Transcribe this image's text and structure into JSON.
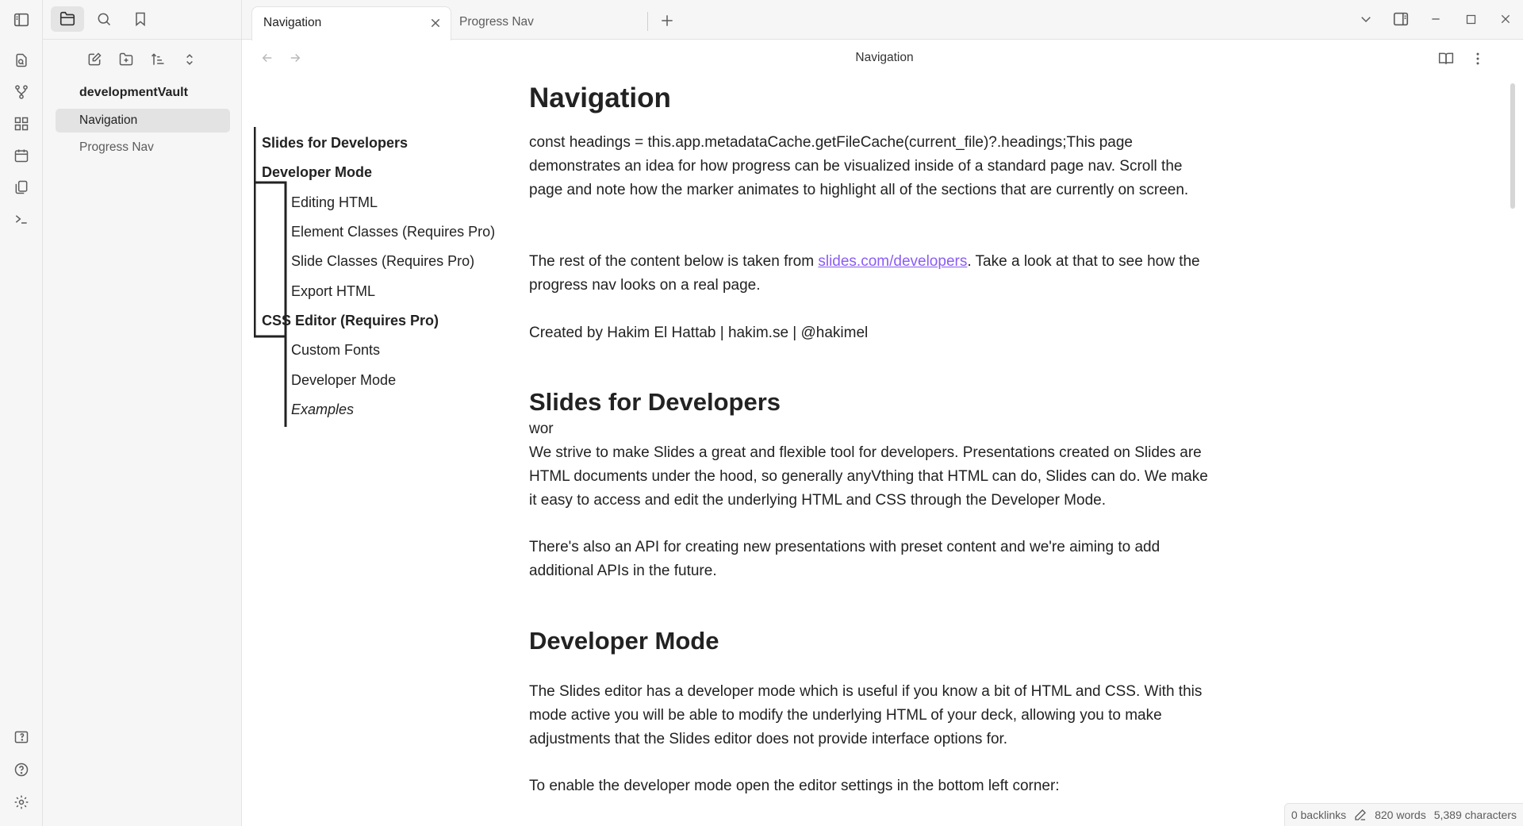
{
  "ribbon": {
    "top_icons": [
      "sidebar-toggle-icon",
      "open-quick-switcher-icon",
      "graph-view-icon",
      "canvas-icon",
      "daily-note-icon",
      "templates-icon",
      "command-palette-icon"
    ],
    "bottom_icons": [
      "vault-switcher-icon",
      "help-icon",
      "settings-icon"
    ]
  },
  "sidebar": {
    "tabs": [
      "files-icon",
      "search-icon",
      "bookmarks-icon"
    ],
    "actions": [
      "new-note-icon",
      "new-folder-icon",
      "sort-icon",
      "collapse-icon"
    ],
    "vault_name": "developmentVault",
    "files": [
      {
        "label": "Navigation",
        "active": true
      },
      {
        "label": "Progress Nav",
        "active": false
      }
    ]
  },
  "tabs": [
    {
      "label": "Navigation",
      "active": true
    },
    {
      "label": "Progress Nav",
      "active": false
    }
  ],
  "view": {
    "title": "Navigation"
  },
  "progress_nav": {
    "items": [
      {
        "label": "Slides for Developers",
        "level": 1
      },
      {
        "label": "Developer Mode",
        "level": 1
      },
      {
        "label": "Editing HTML",
        "level": 2
      },
      {
        "label": "Element Classes (Requires Pro)",
        "level": 2
      },
      {
        "label": "Slide Classes (Requires Pro)",
        "level": 2
      },
      {
        "label": "Export HTML",
        "level": 2
      },
      {
        "label": "CSS Editor (Requires Pro)",
        "level": 1
      },
      {
        "label": "Custom Fonts",
        "level": 2
      },
      {
        "label": "Developer Mode",
        "level": 2
      },
      {
        "label": "Examples",
        "level": 2,
        "italic": true
      }
    ]
  },
  "content": {
    "title": "Navigation",
    "intro": "const headings = this.app.metadataCache.getFileCache(current_file)?.headings;This page demonstrates an idea for how progress can be visualized inside of a standard page nav. Scroll the page and note how the marker animates to highlight all of the sections that are currently on screen.",
    "rest_before": "The rest of the content below is taken from ",
    "rest_link": "slides.com/developers",
    "rest_after": ". Take a look at that to see how the progress nav looks on a real page.",
    "credit": "Created by Hakim El Hattab | hakim.se | @hakimel",
    "h_slides": "Slides for Developers",
    "wor": "wor",
    "slides_p1": "We strive to make Slides a great and flexible tool for developers. Presentations created on Slides are HTML documents under the hood, so generally anyVthing that HTML can do, Slides can do. We make it easy to access and edit the underlying HTML and CSS through the Developer Mode.",
    "slides_p2": "There's also an API for creating new presentations with preset content and we're aiming to add additional APIs in the future.",
    "h_devmode": "Developer Mode",
    "dev_p1": "The Slides editor has a developer mode which is useful if you know a bit of HTML and CSS. With this mode active you will be able to modify the underlying HTML of your deck, allowing you to make adjustments that the Slides editor does not provide interface options for.",
    "dev_p2": "To enable the developer mode open the editor settings in the bottom left corner:"
  },
  "status": {
    "backlinks": "0 backlinks",
    "words": "820 words",
    "characters": "5,389 characters"
  },
  "colors": {
    "accent_link": "#8a5cf5",
    "sidebar_bg": "#f6f6f6"
  }
}
